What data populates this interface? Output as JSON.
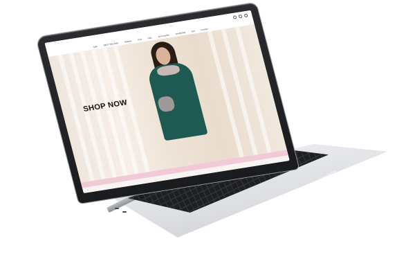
{
  "site": {
    "logo": "",
    "nav": [
      "Sale",
      "BEST SELLING",
      "Women",
      "Prêt",
      "Kids",
      "Accessories",
      "Unstitched",
      "Eid",
      "Contact"
    ],
    "hero": {
      "subtitle": "",
      "cta": "SHOP NOW"
    }
  },
  "colors": {
    "dress": "#1f5a52",
    "accent_bar": "#f2c9d7",
    "laptop_frame": "#1a1b1e",
    "laptop_body": "#dcdee2"
  },
  "icons": [
    "search-icon",
    "user-icon",
    "cart-icon"
  ]
}
